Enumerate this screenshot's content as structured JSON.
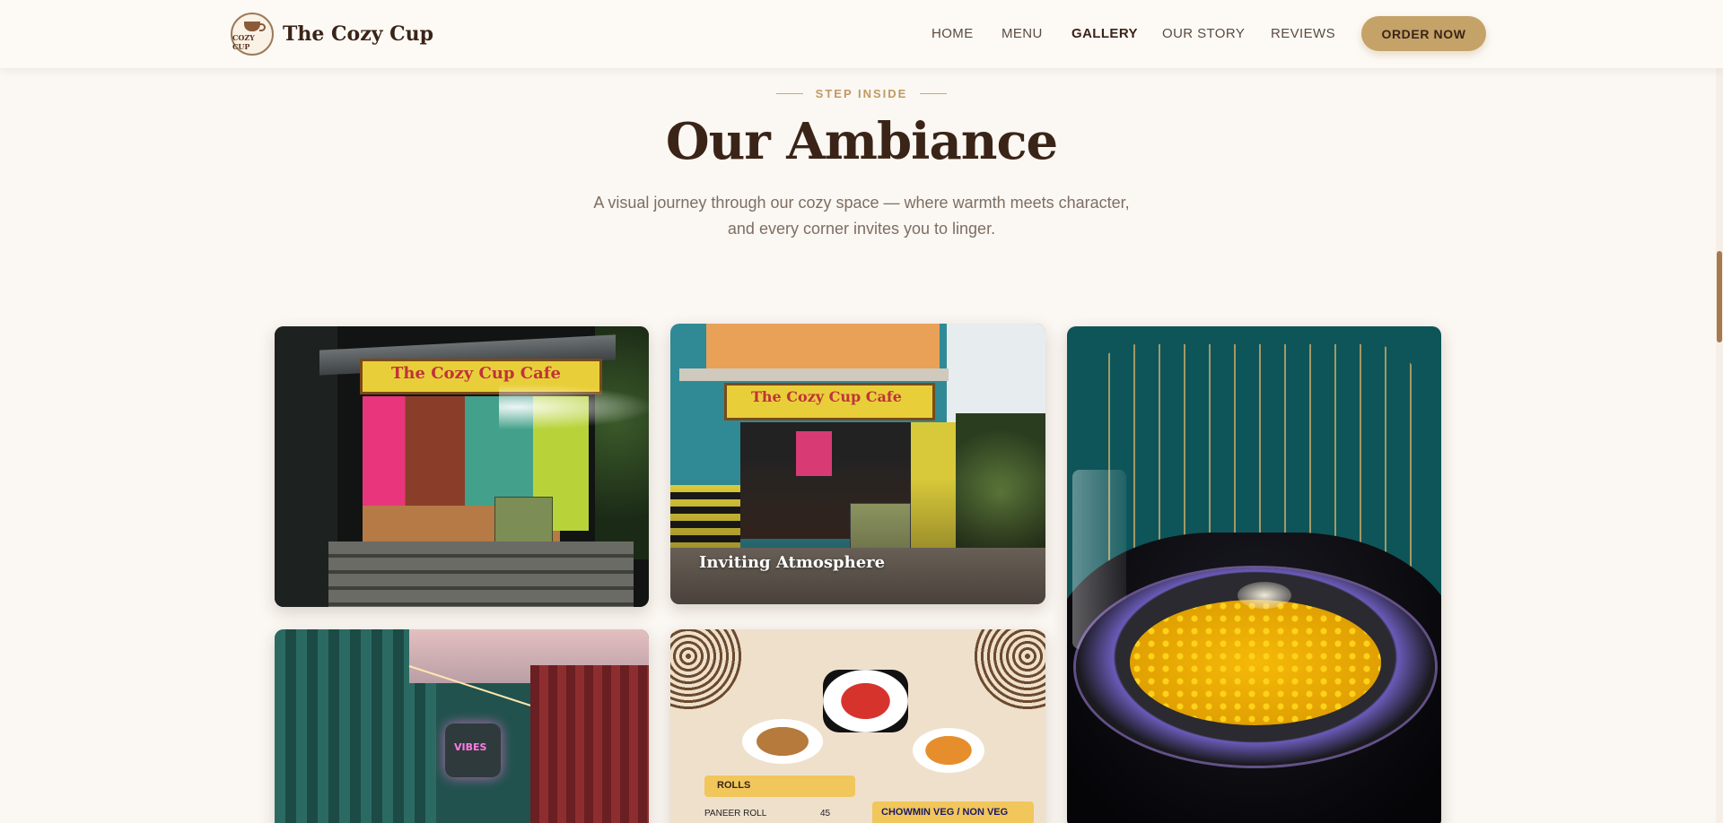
{
  "brand": {
    "name": "The Cozy Cup",
    "logo_text": "COZY CUP"
  },
  "nav": {
    "items": [
      {
        "label": "HOME"
      },
      {
        "label": "MENU"
      },
      {
        "label": "GALLERY",
        "active": true
      },
      {
        "label": "OUR STORY"
      },
      {
        "label": "REVIEWS"
      }
    ],
    "cta": "ORDER NOW"
  },
  "section": {
    "eyebrow": "STEP INSIDE",
    "title": "Our Ambiance",
    "subtitle": "A visual journey through our cozy space — where warmth meets character, and every corner invites you to linger."
  },
  "gallery": {
    "items": [
      {
        "signage": "The Cozy Cup Cafe"
      },
      {
        "signage": "The Cozy Cup Cafe",
        "caption": "Inviting Atmosphere"
      },
      {},
      {
        "neon": "VIBES"
      },
      {
        "menu_section": "ROLLS",
        "menu_row": "PANEER ROLL",
        "menu_price": "45",
        "menu_section_2": "CHOWMIN  VEG / NON VEG"
      }
    ]
  },
  "colors": {
    "accent": "#c4a268",
    "text": "#3a2418",
    "background": "#fbf7f2"
  }
}
